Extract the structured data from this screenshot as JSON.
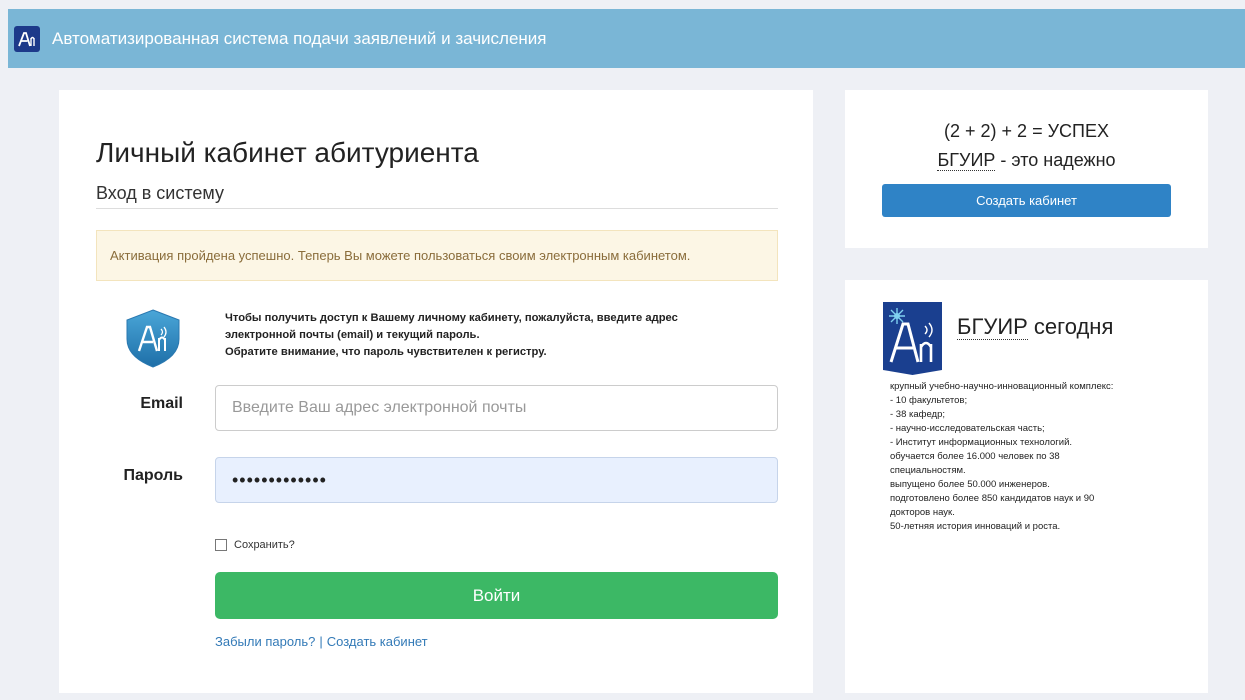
{
  "header": {
    "title": "Автоматизированная система подачи заявлений и зачисления"
  },
  "login": {
    "heading": "Личный кабинет абитуриента",
    "subheading": "Вход в систему",
    "alert": "Активация пройдена успешно. Теперь Вы можете пользоваться своим электронным кабинетом.",
    "instructions": [
      "Чтобы получить доступ к Вашему личному кабинету, пожалуйста, введите адрес",
      "электронной почты (email) и текущий пароль.",
      "Обратите внимание, что пароль чувствителен к регистру."
    ],
    "email_label": "Email",
    "email_placeholder": "Введите Ваш адрес электронной почты",
    "email_value": "",
    "password_label": "Пароль",
    "password_value": "•••••••••••••",
    "remember_label": "Сохранить?",
    "submit_label": "Войти",
    "forgot_link": "Забыли пароль?",
    "link_separator": "|",
    "create_link": "Создать кабинет"
  },
  "promo": {
    "line1": "(2 + 2) + 2 = УСПЕХ",
    "abbr": "БГУИР",
    "line2_rest": " - это надежно",
    "button_label": "Создать кабинет"
  },
  "info": {
    "abbr": "БГУИР",
    "heading_rest": " сегодня",
    "facts": [
      "крупный учебно-научно-инновационный комплекс:",
      "- 10 факультетов;",
      "- 38 кафедр;",
      "- научно-исследовательская часть;",
      "- Институт информационных технологий.",
      "обучается более 16.000 человек по 38",
      "специальностям.",
      "выпущено более 50.000 инженеров.",
      "подготовлено более 850 кандидатов наук и 90",
      "докторов наук.",
      "50-летняя история инноваций и роста."
    ]
  },
  "colors": {
    "header_bg": "#7ab6d6",
    "login_button": "#3cb865",
    "create_button": "#2f83c6",
    "link": "#337ab7",
    "alert_bg": "#fcf6e5"
  }
}
